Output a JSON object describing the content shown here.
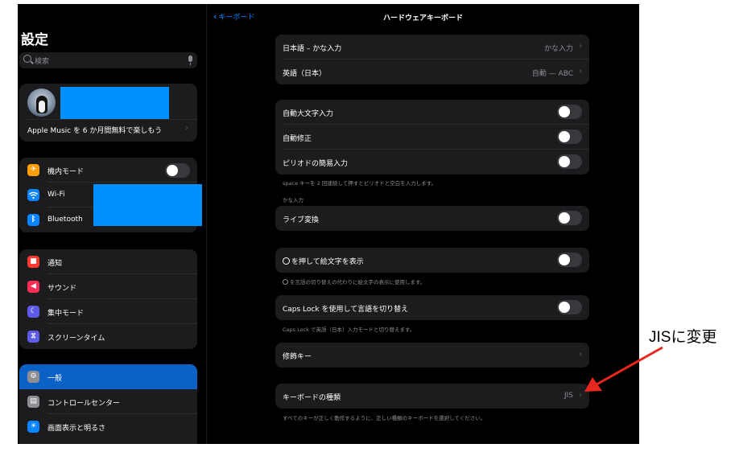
{
  "sidebar": {
    "title": "設定",
    "search_placeholder": "検索",
    "profile": {
      "promo_text": "Apple Music を 6 か月間無料で楽しもう"
    },
    "connectivity": [
      {
        "label": "機内モード",
        "icon": "airplane-icon",
        "color": "#ff9f0a",
        "toggle": "off"
      },
      {
        "label": "Wi-Fi",
        "icon": "wifi-icon",
        "color": "#0a84ff"
      },
      {
        "label": "Bluetooth",
        "icon": "bluetooth-icon",
        "color": "#0a84ff"
      }
    ],
    "notifications": [
      {
        "label": "通知",
        "icon": "notifications-icon",
        "color": "#ff3b30"
      },
      {
        "label": "サウンド",
        "icon": "sound-icon",
        "color": "#ff2d55"
      },
      {
        "label": "集中モード",
        "icon": "focus-moon-icon",
        "color": "#5e5ce6"
      },
      {
        "label": "スクリーンタイム",
        "icon": "screen-time-icon",
        "color": "#5e5ce6"
      }
    ],
    "general": [
      {
        "label": "一般",
        "icon": "gear-icon",
        "color": "#8e8e93",
        "selected": true
      },
      {
        "label": "コントロールセンター",
        "icon": "control-center-icon",
        "color": "#8e8e93"
      },
      {
        "label": "画面表示と明るさ",
        "icon": "brightness-icon",
        "color": "#0a84ff"
      }
    ]
  },
  "main": {
    "back_label": "キーボード",
    "title": "ハードウェアキーボード",
    "layouts": [
      {
        "label": "日本語 – かな入力",
        "value": "かな入力"
      },
      {
        "label": "英語（日本）",
        "value": "自動 — ABC"
      }
    ],
    "auto_options": [
      {
        "label": "自動大文字入力",
        "toggle": "off"
      },
      {
        "label": "自動修正",
        "toggle": "off"
      },
      {
        "label": "ピリオドの簡易入力",
        "toggle": "off"
      }
    ],
    "period_footer": "space キーを 2 回連続して押すとピリオドと空白を入力します。",
    "kana_header": "かな入力",
    "live_conversion": {
      "label": "ライブ変換",
      "toggle": "off"
    },
    "emoji": {
      "label": "を押して絵文字を表示",
      "toggle": "off"
    },
    "emoji_footer": "を言語の切り替えの代わりに絵文字の表示に使用します。",
    "caps_lock": {
      "label": "Caps Lock を使用して言語を切り替え",
      "toggle": "off"
    },
    "caps_footer": "Caps Lock で英語（日本）入力モードと切り替えます。",
    "modifier_keys": {
      "label": "修飾キー"
    },
    "keyboard_type": {
      "label": "キーボードの種類",
      "value": "JIS"
    },
    "keyboard_type_footer": "すべてのキーが正しく動作するように、正しい種類のキーボードを選択してください。"
  },
  "annotation": {
    "text": "JISに変更",
    "arrow_color": "#e8281e"
  },
  "colors": {
    "background": "#000000",
    "cell": "#1c1c1e",
    "accent": "#0a84ff",
    "selected": "#0b61c6",
    "redaction": "#0091ff"
  }
}
